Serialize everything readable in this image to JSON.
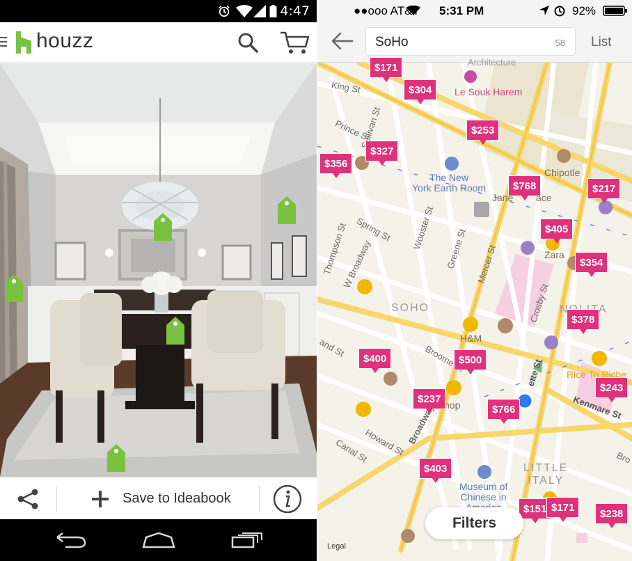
{
  "left_screen": {
    "status_bar": {
      "time": "4:47"
    },
    "app_bar": {
      "brand": "houzz"
    },
    "action_bar": {
      "save_label": "Save to Ideabook"
    }
  },
  "right_screen": {
    "status_bar": {
      "carrier": "●●ooo AT&T",
      "time": "5:31 PM",
      "battery": "92%"
    },
    "nav": {
      "search_value": "SoHo",
      "result_count": "58",
      "list_label": "List"
    },
    "price_pins": [
      {
        "label": "$171"
      },
      {
        "label": "$304"
      },
      {
        "label": "$253"
      },
      {
        "label": "$327"
      },
      {
        "label": "$356"
      },
      {
        "label": "$768"
      },
      {
        "label": "$217"
      },
      {
        "label": "$405"
      },
      {
        "label": "$354"
      },
      {
        "label": "$378"
      },
      {
        "label": "$400"
      },
      {
        "label": "$500"
      },
      {
        "label": "$243"
      },
      {
        "label": "$237"
      },
      {
        "label": "$766"
      },
      {
        "label": "$403"
      },
      {
        "label": "$151"
      },
      {
        "label": "$171"
      },
      {
        "label": "$238"
      }
    ],
    "map_labels": {
      "architecture": "Architecture",
      "le_souk": "Le Souk Harem",
      "king_st": "King St",
      "sullivan_st": "Sullivan St",
      "prince_st": "Prince St",
      "new_york_earth_room": "The New\nYork Earth Room",
      "chipotle": "Chipotle",
      "jane": "Jane",
      "ace": "ace",
      "spring_st": "Spring St",
      "wooster_st": "Wooster St",
      "greene_st": "Greene St",
      "mercer_st": "Mercer St",
      "thompson_st": "Thompson St",
      "w_broadway": "W Broadway",
      "zara": "Zara",
      "soho": "SOHO",
      "nolita": "NOLITA",
      "hm": "H&M",
      "crosby_st": "Crosby St",
      "grand_st": "and St",
      "broome_st": "Broome St",
      "shop": "hop",
      "broadway": "Broadway",
      "ette_st": "ette St",
      "rice_to_riches": "Rice To Riche",
      "kenmare_st": "Kenmare St",
      "canal_st": "Canal St",
      "howard_st": "Howard St",
      "little_italy": "LITTLE\nITALY",
      "museum": "Museum of\nChinese in\nAmerica",
      "bro": "Bro"
    },
    "filters_label": "Filters",
    "legal": "Legal"
  },
  "colors": {
    "houzz_green": "#7ac142",
    "pin_pink": "#e0317c",
    "road_yellow": "#f7d66b",
    "poi_gold": "#f1b800"
  }
}
